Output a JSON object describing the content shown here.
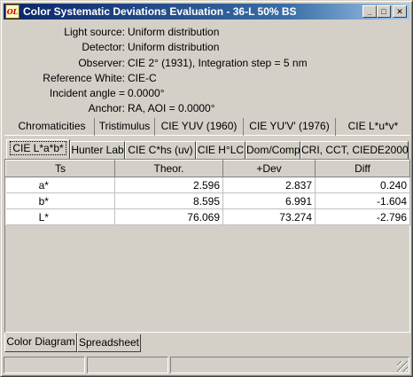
{
  "window": {
    "icon_text": "OL",
    "title": "Color Systematic Deviations Evaluation - 36-L 50% BS",
    "minimize_glyph": "_",
    "maximize_glyph": "□",
    "close_glyph": "✕"
  },
  "info": [
    {
      "label": "Light source:",
      "value": "Uniform distribution"
    },
    {
      "label": "Detector:",
      "value": "Uniform distribution"
    },
    {
      "label": "Observer:",
      "value": "CIE 2° (1931),   Integration step = 5 nm"
    },
    {
      "label": "Reference White:",
      "value": "CIE-C"
    },
    {
      "label": "Incident angle =",
      "value": " 0.0000°"
    },
    {
      "label": "Anchor:",
      "value": "RA,   AOI =  0.0000°"
    }
  ],
  "tabs_row1": [
    "Chromaticities",
    "Tristimulus",
    "CIE YUV (1960)",
    "CIE YU'V' (1976)",
    "CIE L*u*v*"
  ],
  "tabs_row2": [
    "CIE L*a*b*",
    "Hunter Lab",
    "CIE C*hs (uv)",
    "CIE H°LC",
    "Dom/Comp",
    "CRI, CCT, CIEDE2000"
  ],
  "active_tab": "CIE L*a*b*",
  "grid": {
    "headers": [
      "Ts",
      "Theor.",
      "+Dev",
      "Diff"
    ],
    "rows": [
      [
        "a*",
        "2.596",
        "2.837",
        "0.240"
      ],
      [
        "b*",
        "8.595",
        "6.991",
        "-1.604"
      ],
      [
        "L*",
        "76.069",
        "73.274",
        "-2.796"
      ]
    ]
  },
  "bottom_tabs": [
    "Color Diagram",
    "Spreadsheet"
  ],
  "active_bottom_tab": "Color Diagram"
}
